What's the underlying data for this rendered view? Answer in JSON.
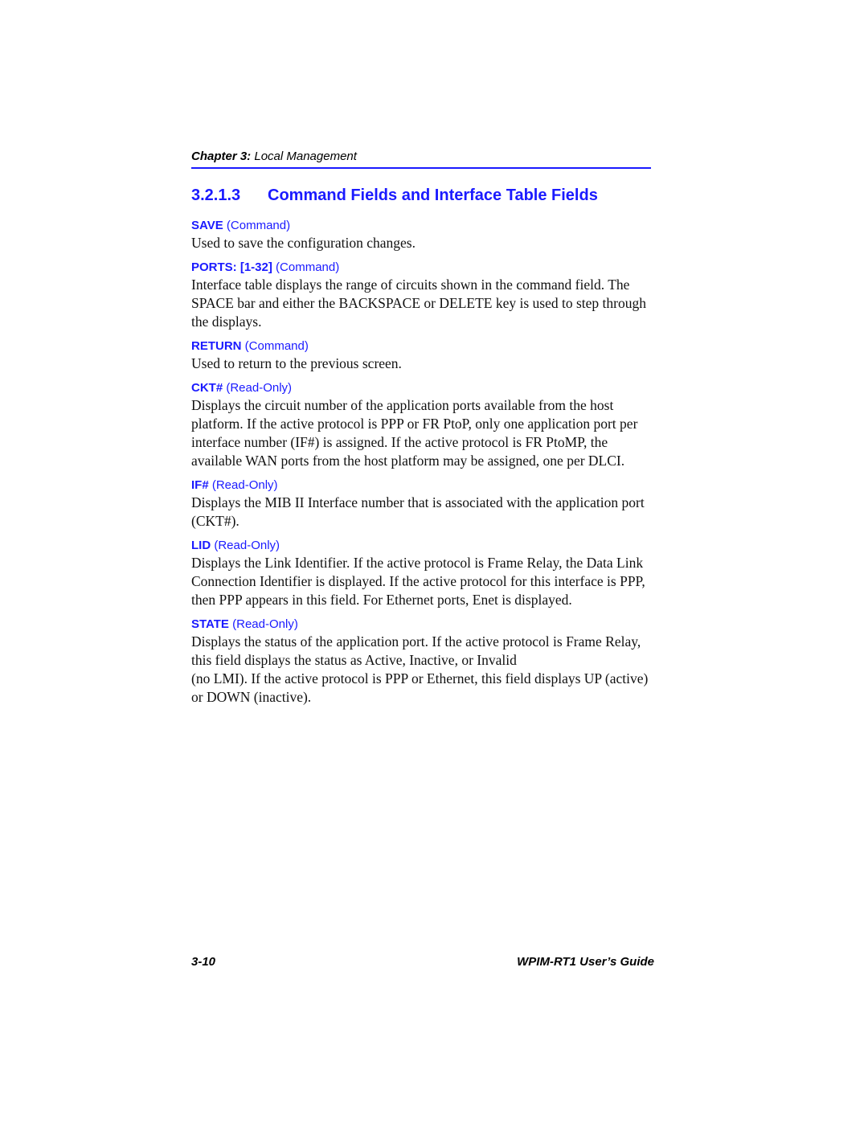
{
  "running_head": {
    "chapter_label": "Chapter 3:",
    "chapter_title": " Local Management"
  },
  "section": {
    "number": "3.2.1.3",
    "title": "Command Fields and Interface Table Fields"
  },
  "fields": [
    {
      "name": "SAVE",
      "type": "(Command)",
      "description": [
        "Used to save the configuration changes."
      ]
    },
    {
      "name": "PORTS: [1-32]",
      "type": "(Command)",
      "description": [
        "Interface table displays the range of circuits shown in the command field. The SPACE bar and either the BACKSPACE or DELETE key is used to step through the displays."
      ]
    },
    {
      "name": "RETURN",
      "type": "(Command)",
      "description": [
        "Used to return to the previous screen."
      ]
    },
    {
      "name": "CKT#",
      "type": "(Read-Only)",
      "description": [
        "Displays the circuit number of the application ports available from the host platform. If the active protocol is PPP or FR PtoP, only one application port per interface number (IF#) is assigned. If the active protocol is FR PtoMP, the available WAN ports from the host platform may be assigned, one per DLCI."
      ]
    },
    {
      "name": "IF#",
      "type": "(Read-Only)",
      "description": [
        "Displays the MIB II Interface number that is associated with the application port (CKT#)."
      ]
    },
    {
      "name": "LID",
      "type": "(Read-Only)",
      "description": [
        "Displays the Link Identifier. If the active protocol is Frame Relay, the Data Link Connection Identifier is displayed. If the active protocol for this interface is PPP, then PPP appears in this field. For Ethernet ports, Enet is displayed."
      ]
    },
    {
      "name": "STATE",
      "type": "(Read-Only)",
      "description": [
        "Displays the status of the application port. If the active protocol is Frame Relay, this field displays the status as Active, Inactive, or Invalid",
        "(no LMI). If the active protocol is PPP or Ethernet, this field displays UP (active) or DOWN (inactive)."
      ]
    }
  ],
  "footer": {
    "page_number": "3-10",
    "guide_title": "WPIM-RT1 User’s Guide"
  },
  "colors": {
    "accent_blue": "#1a1aff",
    "text": "#111111"
  }
}
